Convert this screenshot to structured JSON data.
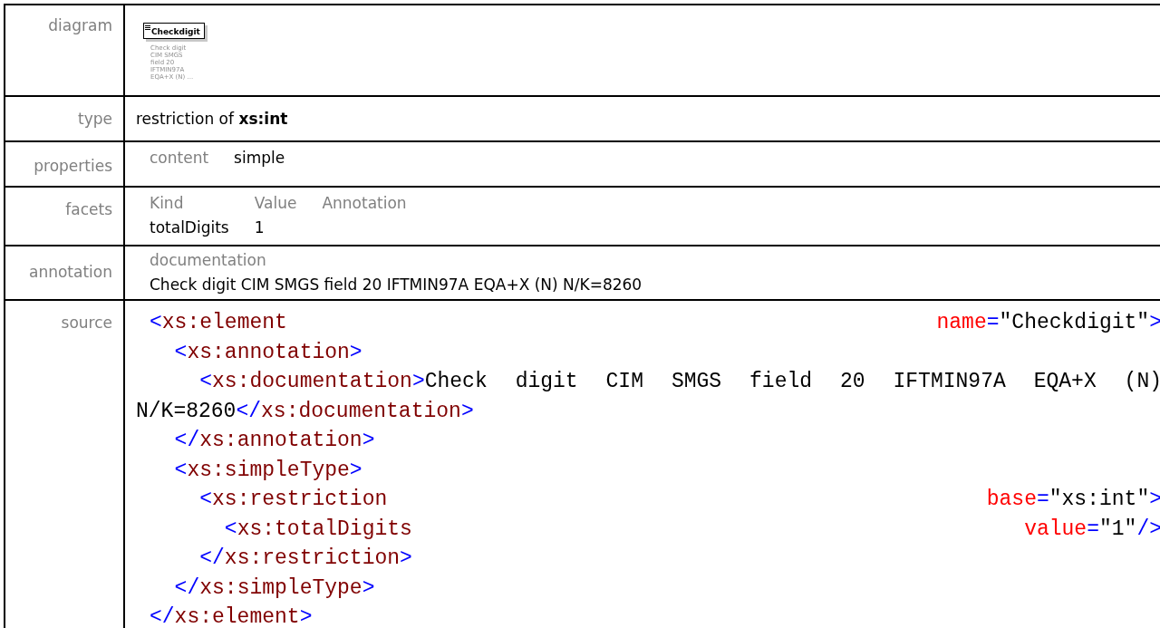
{
  "rows": [
    {
      "kind": "diagram",
      "label": "diagram",
      "element": "Checkdigit",
      "note_lines": [
        "Check digit",
        "CIM SMGS",
        "field 20",
        "IFTMIN97A",
        "EQA+X (N) ..."
      ]
    },
    {
      "kind": "type",
      "label": "type",
      "text": "restriction of **xs:int**"
    },
    {
      "kind": "properties",
      "label": "properties",
      "pairs": [
        {
          "key": "content",
          "value": "simple"
        }
      ]
    },
    {
      "kind": "facets",
      "label": "facets",
      "columns": [
        "Kind",
        "Value",
        "Annotation"
      ],
      "rows": [
        [
          "totalDigits",
          "1"
        ]
      ]
    },
    {
      "kind": "annotation",
      "label": "annotation",
      "heading": "documentation",
      "text": "Check digit CIM SMGS field 20 IFTMIN97A EQA+X (N) N/K=8260"
    },
    {
      "kind": "source",
      "label": "source",
      "lines": [
        {
          "tokens": [
            {
              "kind": "punct",
              "text": "<"
            },
            {
              "kind": "tag",
              "text": "xs:element"
            }
          ],
          "right": [
            {
              "kind": "attr",
              "text": "name"
            },
            {
              "kind": "punct",
              "text": "="
            },
            {
              "kind": "value",
              "text": "\"Checkdigit\""
            },
            {
              "kind": "punct",
              "text": ">"
            }
          ]
        },
        {
          "tokens": [
            {
              "kind": "punct",
              "text": "  <"
            },
            {
              "kind": "tag",
              "text": "xs:annotation"
            },
            {
              "kind": "punct",
              "text": ">"
            }
          ]
        },
        {
          "tokens": [
            {
              "kind": "punct",
              "text": "    <"
            },
            {
              "kind": "tag",
              "text": "xs:documentation"
            },
            {
              "kind": "punct",
              "text": ">"
            },
            {
              "kind": "value",
              "text": "Check digit CIM SMGS field 20 IFTMIN97A EQA+X (N) N/K=8260"
            },
            {
              "kind": "punct",
              "text": "</"
            },
            {
              "kind": "tag",
              "text": "xs:documentation"
            },
            {
              "kind": "punct",
              "text": ">"
            }
          ]
        },
        {
          "tokens": [
            {
              "kind": "punct",
              "text": "  </"
            },
            {
              "kind": "tag",
              "text": "xs:annotation"
            },
            {
              "kind": "punct",
              "text": ">"
            }
          ]
        },
        {
          "tokens": [
            {
              "kind": "punct",
              "text": "  <"
            },
            {
              "kind": "tag",
              "text": "xs:simpleType"
            },
            {
              "kind": "punct",
              "text": ">"
            }
          ]
        },
        {
          "tokens": [
            {
              "kind": "punct",
              "text": "    <"
            },
            {
              "kind": "tag",
              "text": "xs:restriction"
            }
          ],
          "right": [
            {
              "kind": "attr",
              "text": "base"
            },
            {
              "kind": "punct",
              "text": "="
            },
            {
              "kind": "value",
              "text": "\"xs:int\""
            },
            {
              "kind": "punct",
              "text": ">"
            }
          ]
        },
        {
          "tokens": [
            {
              "kind": "punct",
              "text": "      <"
            },
            {
              "kind": "tag",
              "text": "xs:totalDigits"
            }
          ],
          "right": [
            {
              "kind": "attr",
              "text": "value"
            },
            {
              "kind": "punct",
              "text": "="
            },
            {
              "kind": "value",
              "text": "\"1\""
            },
            {
              "kind": "punct",
              "text": "/>"
            }
          ]
        },
        {
          "tokens": [
            {
              "kind": "punct",
              "text": "    </"
            },
            {
              "kind": "tag",
              "text": "xs:restriction"
            },
            {
              "kind": "punct",
              "text": ">"
            }
          ]
        },
        {
          "tokens": [
            {
              "kind": "punct",
              "text": "  </"
            },
            {
              "kind": "tag",
              "text": "xs:simpleType"
            },
            {
              "kind": "punct",
              "text": ">"
            }
          ]
        },
        {
          "tokens": [
            {
              "kind": "punct",
              "text": "</"
            },
            {
              "kind": "tag",
              "text": "xs:element"
            },
            {
              "kind": "punct",
              "text": ">"
            }
          ]
        }
      ]
    }
  ]
}
